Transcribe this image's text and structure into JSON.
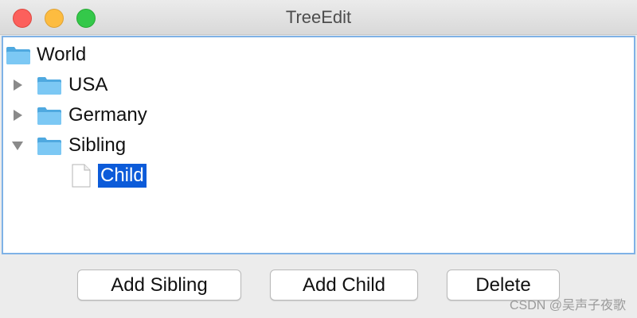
{
  "window": {
    "title": "TreeEdit"
  },
  "tree": {
    "root": {
      "label": "World",
      "icon": "folder-icon"
    },
    "nodes": [
      {
        "label": "USA",
        "icon": "folder-icon",
        "expanded": false
      },
      {
        "label": "Germany",
        "icon": "folder-icon",
        "expanded": false
      },
      {
        "label": "Sibling",
        "icon": "folder-icon",
        "expanded": true,
        "children": [
          {
            "label": "Child",
            "icon": "file-icon",
            "selected": true
          }
        ]
      }
    ]
  },
  "buttons": {
    "add_sibling": "Add Sibling",
    "add_child": "Add Child",
    "delete": "Delete"
  },
  "watermark": "CSDN @吴声子夜歌",
  "colors": {
    "selection": "#0c5bd9",
    "tree_border": "#7fb2e6",
    "folder": "#5ab8ef"
  }
}
